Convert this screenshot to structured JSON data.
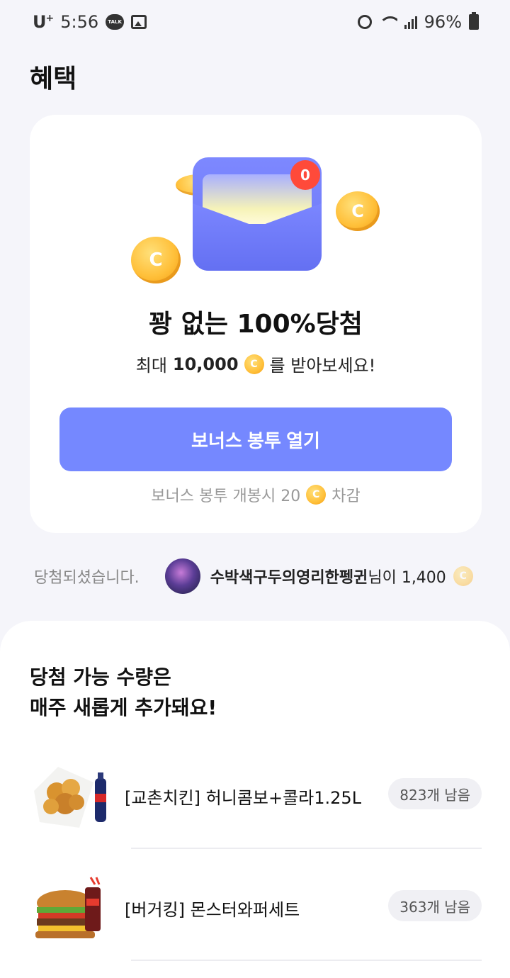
{
  "status_bar": {
    "carrier": "U",
    "carrier_sup": "+",
    "time": "5:56",
    "talk_label": "TALK",
    "battery": "96%"
  },
  "page": {
    "title": "혜택"
  },
  "promo": {
    "badge_count": "0",
    "coin_symbol": "C",
    "headline": "꽝 없는 100%당첨",
    "sub_prefix": "최대",
    "sub_amount": "10,000",
    "sub_suffix": "를 받아보세요!",
    "button_label": "보너스 봉투 열기",
    "cost_prefix": "보너스 봉투 개봉시 20",
    "cost_suffix": "차감"
  },
  "ticker": {
    "fade_text": "당첨되셨습니다.",
    "winner_name": "수박색구두의영리한펭귄",
    "message": "님이 1,400"
  },
  "prizes_section": {
    "title_line1": "당첨 가능 수량은",
    "title_line2": "매주 새롭게 추가돼요!",
    "items": [
      {
        "name": "[교촌치킨] 허니콤보+콜라1.25L",
        "stock": "823개 남음",
        "thumb": "chicken-cola-image"
      },
      {
        "name": "[버거킹] 몬스터와퍼세트",
        "stock": "363개 남음",
        "thumb": "burger-set-image"
      }
    ]
  },
  "colors": {
    "accent": "#7588ff",
    "badge": "#ff4a3a",
    "coin": "#ffc03a",
    "page_bg": "#f5f5fa"
  }
}
